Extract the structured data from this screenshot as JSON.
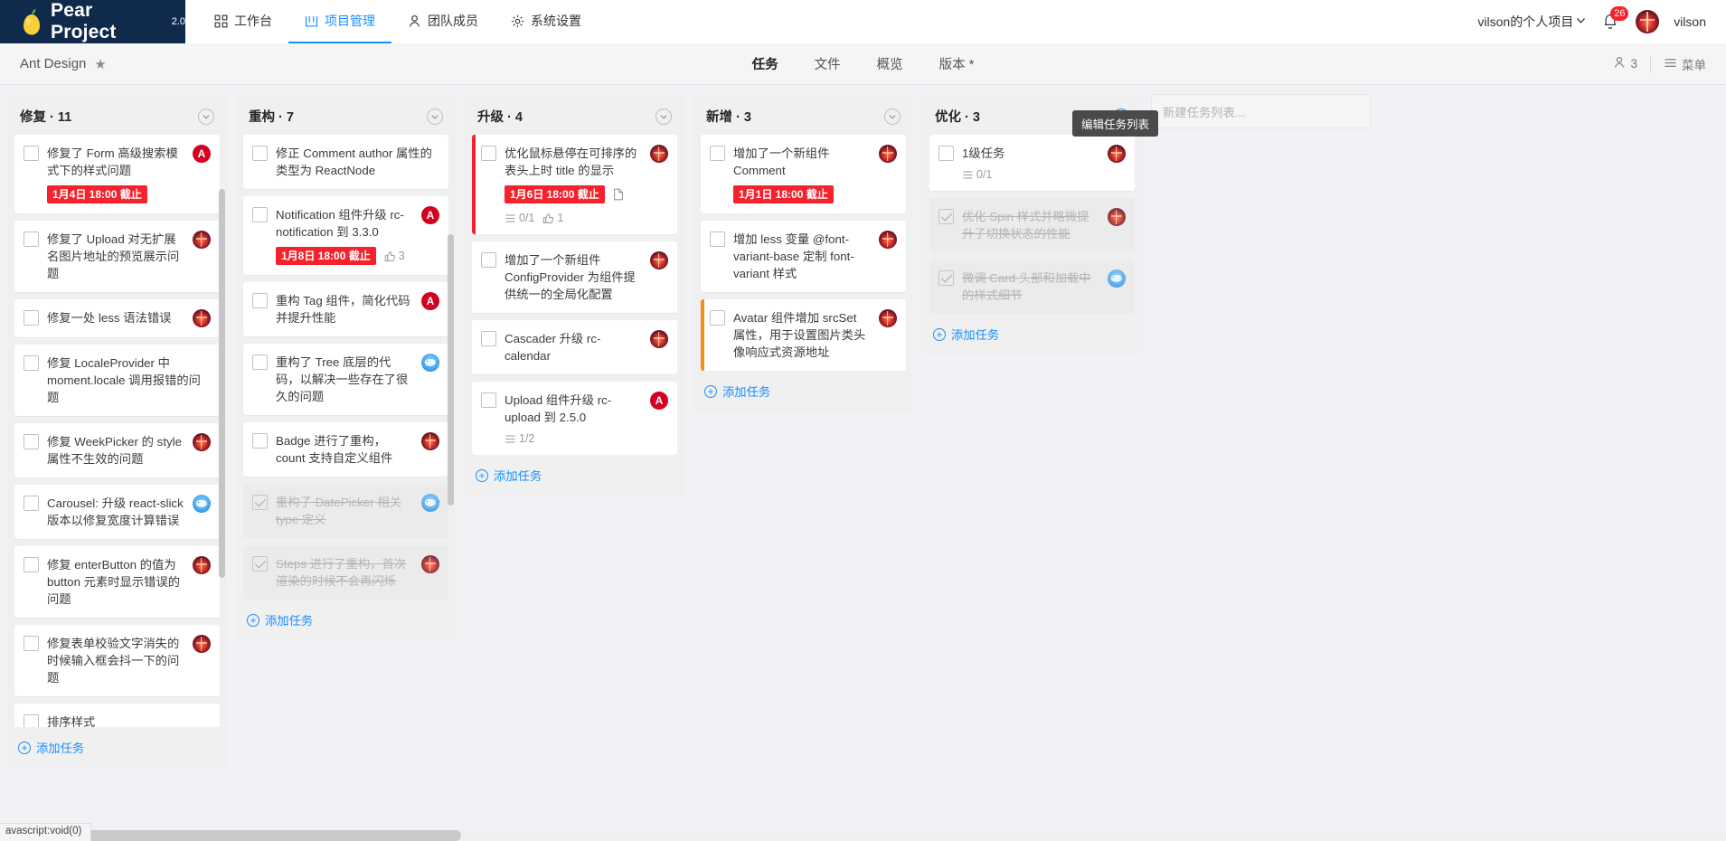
{
  "brand": {
    "name": "Pear Project",
    "version": "2.0"
  },
  "nav": [
    {
      "label": "工作台",
      "icon": "grid-icon",
      "active": false
    },
    {
      "label": "项目管理",
      "icon": "project-icon",
      "active": true
    },
    {
      "label": "团队成员",
      "icon": "team-icon",
      "active": false
    },
    {
      "label": "系统设置",
      "icon": "gear-icon",
      "active": false
    }
  ],
  "topright": {
    "project_selector": "vilson的个人项目",
    "notification_count": "26",
    "username": "vilson"
  },
  "subheader": {
    "project_title": "Ant Design",
    "star": "★",
    "tabs": [
      {
        "label": "任务",
        "active": true
      },
      {
        "label": "文件",
        "active": false
      },
      {
        "label": "概览",
        "active": false
      },
      {
        "label": "版本 *",
        "active": false
      }
    ],
    "member_count": "3",
    "menu_label": "菜单",
    "tooltip": "编辑任务列表"
  },
  "board": {
    "add_task_label": "添加任务",
    "new_column_placeholder": "新建任务列表...",
    "columns": [
      {
        "title": "修复",
        "count": "11",
        "collapse_highlight": false,
        "cards": [
          {
            "title": "修复了 Form 高级搜索模式下的样式问题",
            "due": "1月4日 18:00 截止",
            "avatar": "a",
            "done": false,
            "priority": ""
          },
          {
            "title": "修复了 Upload 对无扩展名图片地址的预览展示问题",
            "avatar": "photo",
            "done": false,
            "priority": ""
          },
          {
            "title": "修复一处 less 语法错误",
            "avatar": "photo",
            "done": false,
            "priority": ""
          },
          {
            "title": "修复 LocaleProvider 中 moment.locale 调用报错的问题",
            "avatar": "",
            "done": false,
            "priority": ""
          },
          {
            "title": "修复 WeekPicker 的 style 属性不生效的问题",
            "avatar": "photo",
            "done": false,
            "priority": ""
          },
          {
            "title": "Carousel: 升级 react-slick 版本以修复宽度计算错误",
            "avatar": "blue",
            "done": false,
            "priority": ""
          },
          {
            "title": "修复 enterButton 的值为 button 元素时显示错误的问题",
            "avatar": "photo",
            "done": false,
            "priority": ""
          },
          {
            "title": "修复表单校验文字消失的时候输入框会抖一下的问题",
            "avatar": "photo",
            "done": false,
            "priority": ""
          },
          {
            "title": "排序样式",
            "avatar": "",
            "done": false,
            "priority": ""
          }
        ]
      },
      {
        "title": "重构",
        "count": "7",
        "collapse_highlight": false,
        "cards": [
          {
            "title": "修正 Comment author 属性的类型为 ReactNode",
            "avatar": "",
            "done": false,
            "priority": ""
          },
          {
            "title": "Notification 组件升级 rc-notification 到 3.3.0",
            "due": "1月8日 18:00 截止",
            "likes": "3",
            "avatar": "a",
            "done": false,
            "priority": ""
          },
          {
            "title": "重构 Tag 组件，简化代码并提升性能",
            "avatar": "a",
            "done": false,
            "priority": ""
          },
          {
            "title": "重构了 Tree 底层的代码，以解决一些存在了很久的问题",
            "avatar": "blue",
            "done": false,
            "priority": ""
          },
          {
            "title": "Badge 进行了重构，count 支持自定义组件",
            "avatar": "photo",
            "done": false,
            "priority": ""
          },
          {
            "title": "重构子 DatePicker 相关 type 定义",
            "avatar": "blue",
            "done": true,
            "priority": ""
          },
          {
            "title": "Steps 进行了重构，首次渲染的时候不会再闪烁",
            "avatar": "photo",
            "done": true,
            "priority": ""
          }
        ]
      },
      {
        "title": "升级",
        "count": "4",
        "collapse_highlight": false,
        "cards": [
          {
            "title": "优化鼠标悬停在可排序的表头上时 title 的显示",
            "due": "1月6日 18:00 截止",
            "has_file": true,
            "checklist": "0/1",
            "likes": "1",
            "avatar": "photo",
            "done": false,
            "priority": "red"
          },
          {
            "title": "增加了一个新组件 ConfigProvider 为组件提供统一的全局化配置",
            "avatar": "photo",
            "done": false,
            "priority": ""
          },
          {
            "title": "Cascader 升级 rc-calendar",
            "avatar": "photo",
            "done": false,
            "priority": ""
          },
          {
            "title": "Upload 组件升级 rc-upload 到 2.5.0",
            "checklist": "1/2",
            "avatar": "a",
            "done": false,
            "priority": ""
          }
        ]
      },
      {
        "title": "新增",
        "count": "3",
        "collapse_highlight": false,
        "cards": [
          {
            "title": "增加了一个新组件 Comment",
            "due": "1月1日 18:00 截止",
            "avatar": "photo",
            "done": false,
            "priority": ""
          },
          {
            "title": "增加 less 变量 @font-variant-base 定制 font-variant 样式",
            "avatar": "photo",
            "done": false,
            "priority": ""
          },
          {
            "title": "Avatar 组件增加 srcSet 属性，用于设置图片类头像响应式资源地址",
            "avatar": "photo",
            "done": false,
            "priority": "orange"
          }
        ]
      },
      {
        "title": "优化",
        "count": "3",
        "collapse_highlight": true,
        "cards": [
          {
            "title": "1级任务",
            "checklist": "0/1",
            "avatar": "photo",
            "done": false,
            "priority": ""
          },
          {
            "title": "优化 Spin 样式并略微提升子切换状态的性能",
            "avatar": "photo",
            "done": true,
            "priority": ""
          },
          {
            "title": "微调 Card 头部和加载中的样式细节",
            "avatar": "blue",
            "done": true,
            "priority": ""
          }
        ]
      }
    ]
  },
  "statusbar": {
    "text": "avascript:void(0)"
  }
}
